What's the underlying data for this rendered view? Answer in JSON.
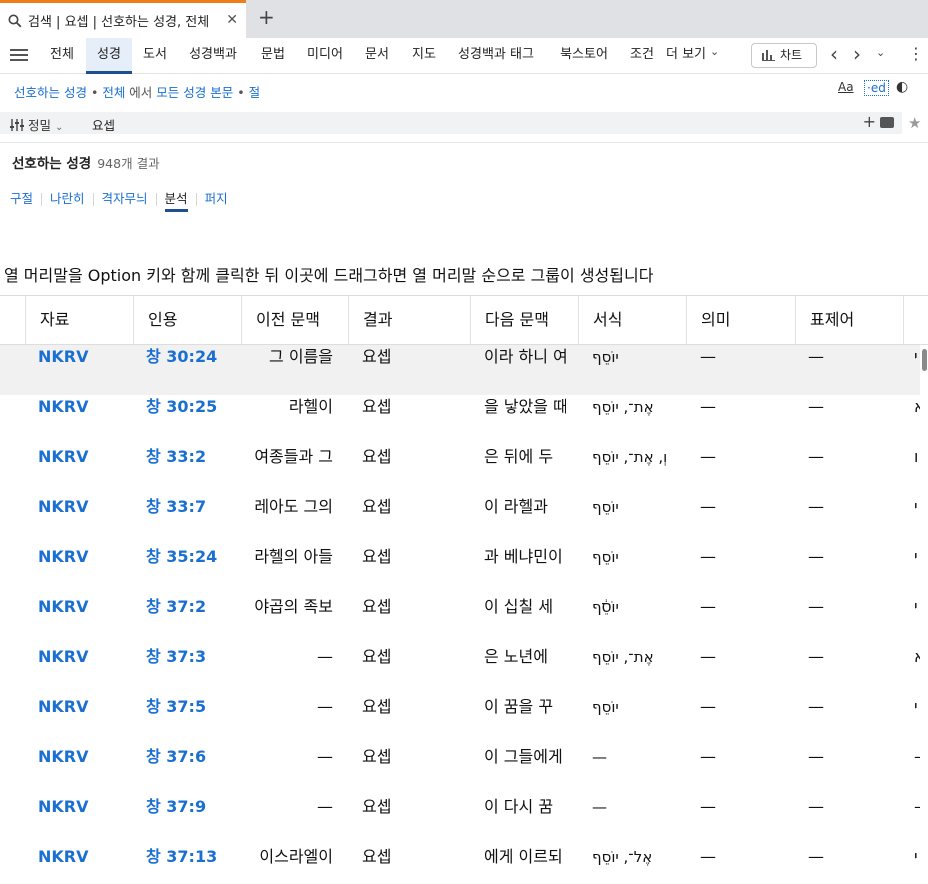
{
  "tab": {
    "title": "검색 | 요셉 | 선호하는 성경, 전체",
    "close": "✕",
    "new": "+"
  },
  "nav": {
    "items": [
      "전체",
      "성경",
      "도서",
      "성경백과",
      "문법",
      "미디어",
      "문서",
      "지도",
      "성경백과 태그",
      "북스토어",
      "조건",
      "더 보기"
    ],
    "more_caret": "⌄",
    "chart_label": "차트",
    "prev": "‹",
    "next": "›",
    "caret": "⌄",
    "kebab": "⋮"
  },
  "scope": {
    "bible": "선호하는 성경",
    "sep1": " • ",
    "all": "전체",
    "in": " 에서 ",
    "field": "모든 성경 본문",
    "sep2": " • ",
    "unit": "절",
    "icon_font": "Aa",
    "icon_ed": "·ed",
    "icon_theme": "◐"
  },
  "search": {
    "sort_label": "정밀",
    "sort_caret": "⌄",
    "query": "요셉",
    "plus": "+",
    "star": "★"
  },
  "results": {
    "title": "선호하는 성경",
    "count": "948개 결과"
  },
  "view_tabs": [
    "구절",
    "나란히",
    "격자무늬",
    "분석",
    "퍼지"
  ],
  "group_hint": "열 머리말을 Option 키와 함께 클릭한 뒤 이곳에 드래그하면 열 머리말 순으로 그룹이 생성됩니다",
  "columns": [
    "자료",
    "인용",
    "이전 문맥",
    "결과",
    "다음 문맥",
    "서식",
    "의미",
    "표제어"
  ],
  "rows": [
    {
      "src": "NKRV",
      "ref": "창 30:24",
      "prev": "그 이름을 ",
      "res": "요셉",
      "next": "이라 하니 여",
      "form": "יוֹסֵף",
      "mean": "—",
      "lemma": "—",
      "edge": "י"
    },
    {
      "src": "NKRV",
      "ref": "창 30:25",
      "prev": "라헬이",
      "res": "요셉",
      "next": "을 낳았을 때",
      "form": "אֶת־, יוֹסֵף",
      "mean": "—",
      "lemma": "—",
      "edge": "א"
    },
    {
      "src": "NKRV",
      "ref": "창 33:2",
      "prev": "여종들과 그 ",
      "res": "요셉",
      "next": "은 뒤에 두",
      "form": "וְ, אֶת־, יוֹסֵף",
      "mean": "—",
      "lemma": "—",
      "edge": "ו"
    },
    {
      "src": "NKRV",
      "ref": "창 33:7",
      "prev": "레아도 그의",
      "res": "요셉",
      "next": "이 라헬과",
      "form": "יוֹסֵף",
      "mean": "—",
      "lemma": "—",
      "edge": "י"
    },
    {
      "src": "NKRV",
      "ref": "창 35:24",
      "prev": "라헬의 아들",
      "res": "요셉",
      "next": "과 베냐민이",
      "form": "יוֹסֵף",
      "mean": "—",
      "lemma": "—",
      "edge": "י"
    },
    {
      "src": "NKRV",
      "ref": "창 37:2",
      "prev": "야곱의 족보",
      "res": "요셉",
      "next": "이 십칠 세",
      "form": "יוֹסֵ֔ף",
      "mean": "—",
      "lemma": "—",
      "edge": "י"
    },
    {
      "src": "NKRV",
      "ref": "창 37:3",
      "prev": "—",
      "res": "요셉",
      "next": "은 노년에",
      "form": "אֶת־, יוֹסֵף",
      "mean": "—",
      "lemma": "—",
      "edge": "א"
    },
    {
      "src": "NKRV",
      "ref": "창 37:5",
      "prev": "—",
      "res": "요셉",
      "next": "이 꿈을 꾸",
      "form": "יוֹסֵף",
      "mean": "—",
      "lemma": "—",
      "edge": "י"
    },
    {
      "src": "NKRV",
      "ref": "창 37:6",
      "prev": "—",
      "res": "요셉",
      "next": "이 그들에게",
      "form": "—",
      "mean": "—",
      "lemma": "—",
      "edge": "—"
    },
    {
      "src": "NKRV",
      "ref": "창 37:9",
      "prev": "—",
      "res": "요셉",
      "next": "이 다시 꿈",
      "form": "—",
      "mean": "—",
      "lemma": "—",
      "edge": "—"
    },
    {
      "src": "NKRV",
      "ref": "창 37:13",
      "prev": "이스라엘이",
      "res": "요셉",
      "next": "에게 이르되",
      "form": "אֶל־, יוֹסֵף",
      "mean": "—",
      "lemma": "—",
      "edge": "י"
    }
  ]
}
